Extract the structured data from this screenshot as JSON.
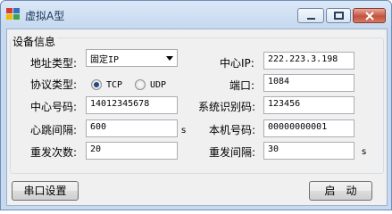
{
  "window": {
    "title": "虚拟A型",
    "controls": [
      "minimize-icon",
      "maximize-icon",
      "close-icon"
    ]
  },
  "group": {
    "title": "设备信息"
  },
  "fields": {
    "address_type": {
      "label": "地址类型:",
      "value": "固定IP"
    },
    "protocol_type": {
      "label": "协议类型:",
      "options": [
        "TCP",
        "UDP"
      ],
      "selected": "TCP"
    },
    "center_number": {
      "label": "中心号码:",
      "value": "14012345678"
    },
    "heartbeat": {
      "label": "心跳间隔:",
      "value": "600",
      "unit": "s"
    },
    "retry_count": {
      "label": "重发次数:",
      "value": "20"
    },
    "center_ip": {
      "label": "中心IP:",
      "value": "222.223.3.198"
    },
    "port": {
      "label": "端口:",
      "value": "1084"
    },
    "system_id": {
      "label": "系统识别码:",
      "value": "123456"
    },
    "local_number": {
      "label": "本机号码:",
      "value": "00000000001"
    },
    "retry_interval": {
      "label": "重发间隔:",
      "value": "30",
      "unit": "s"
    }
  },
  "buttons": {
    "serial_settings": "串口设置",
    "start": "启　动"
  }
}
